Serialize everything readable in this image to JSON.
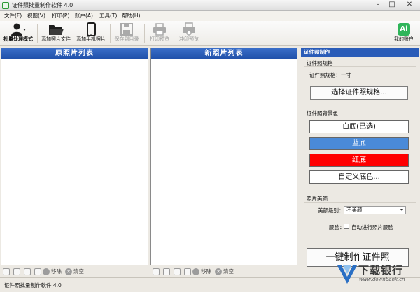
{
  "window": {
    "title": "证件照批量制作软件 4.0"
  },
  "menu": [
    {
      "label": "文件(F)"
    },
    {
      "label": "视图(V)"
    },
    {
      "label": "打印(P)"
    },
    {
      "label": "账户(A)"
    },
    {
      "label": "工具(T)"
    },
    {
      "label": "帮助(H)"
    }
  ],
  "toolbar": {
    "batch_mode": "批量处理模式",
    "add_file": "添加照片文件",
    "add_phone": "添加手机照片",
    "save_dir": "保存到目录",
    "print_preview": "打印预览",
    "print_out": "冲印预览",
    "my_account": "我的账户",
    "ai_label": "Ai"
  },
  "panels": {
    "original_title": "原照片列表",
    "new_title": "新照片列表",
    "remove": "移除",
    "clear": "清空"
  },
  "side": {
    "title": "证件照制作",
    "spec_group": "证件照规格",
    "spec_text": "证件照规格：一寸",
    "choose_spec": "选择证件照规格...",
    "bg_group": "证件照背景色",
    "bg_white": "白底(已选)",
    "bg_blue": "蓝底",
    "bg_red": "红底",
    "bg_custom": "自定义底色...",
    "beauty_group": "照片美颜",
    "beauty_level_label": "美颜级别：",
    "beauty_level_value": "不美颜",
    "skin_label": "腰脸：",
    "skin_check": "自动进行照片腰脸",
    "make_button": "一键制作证件照"
  },
  "colors": {
    "blue_bg": "#4a8ad8",
    "red_bg": "#ff0000",
    "header_blue": "#2557b3"
  },
  "status": {
    "text": "证件照批量制作软件 4.0"
  },
  "watermark": {
    "name": "下载银行",
    "url": "www.downbank.cn"
  }
}
